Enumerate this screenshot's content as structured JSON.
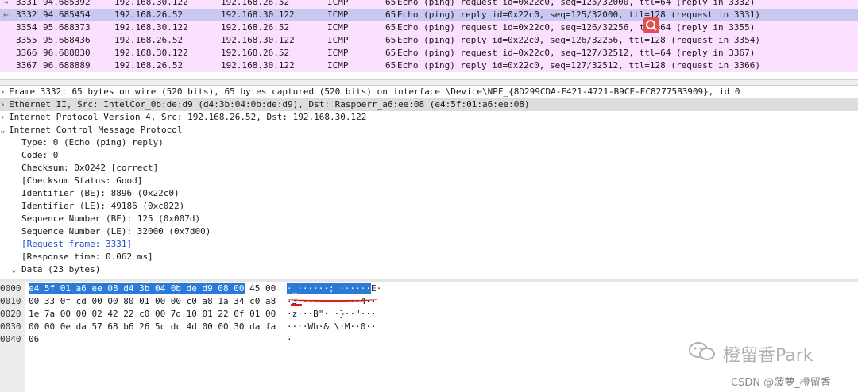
{
  "colors": {
    "icmp_row_bg": "#fce0ff",
    "selected_row_bg": "#c8c8f0",
    "byte_selection": "#2b7bd6",
    "annotation_red": "#d81e1e",
    "details_highlight": "#dddddd"
  },
  "packets": [
    {
      "marker": "→",
      "no": "3331",
      "time": "94.685392",
      "src": "192.168.30.122",
      "dst": "192.168.26.52",
      "proto": "ICMP",
      "len": "65",
      "info": "Echo (ping) request  id=0x22c0, seq=125/32000, ttl=64 (reply in 3332)",
      "selected": false
    },
    {
      "marker": "←",
      "no": "3332",
      "time": "94.685454",
      "src": "192.168.26.52",
      "dst": "192.168.30.122",
      "proto": "ICMP",
      "len": "65",
      "info": "Echo (ping) reply    id=0x22c0, seq=125/32000, ttl=128 (request in 3331)",
      "selected": true
    },
    {
      "marker": "",
      "no": "3354",
      "time": "95.688373",
      "src": "192.168.30.122",
      "dst": "192.168.26.52",
      "proto": "ICMP",
      "len": "65",
      "info": "Echo (ping) request  id=0x22c0, seq=126/32256, ttl=64 (reply in 3355)",
      "selected": false
    },
    {
      "marker": "",
      "no": "3355",
      "time": "95.688436",
      "src": "192.168.26.52",
      "dst": "192.168.30.122",
      "proto": "ICMP",
      "len": "65",
      "info": "Echo (ping) reply    id=0x22c0, seq=126/32256, ttl=128 (request in 3354)",
      "selected": false
    },
    {
      "marker": "",
      "no": "3366",
      "time": "96.688830",
      "src": "192.168.30.122",
      "dst": "192.168.26.52",
      "proto": "ICMP",
      "len": "65",
      "info": "Echo (ping) request  id=0x22c0, seq=127/32512, ttl=64 (reply in 3367)",
      "selected": false
    },
    {
      "marker": "",
      "no": "3367",
      "time": "96.688889",
      "src": "192.168.26.52",
      "dst": "192.168.30.122",
      "proto": "ICMP",
      "len": "65",
      "info": "Echo (ping) reply    id=0x22c0, seq=127/32512, ttl=128 (request in 3366)",
      "selected": false
    }
  ],
  "details": [
    {
      "twisty": "›",
      "indent": 0,
      "text": "Frame 3332: 65 bytes on wire (520 bits), 65 bytes captured (520 bits) on interface \\Device\\NPF_{8D299CDA-F421-4721-B9CE-EC82775B3909}, id 0",
      "highlight": false,
      "link": false
    },
    {
      "twisty": "›",
      "indent": 0,
      "text": "Ethernet II, Src: IntelCor_0b:de:d9 (d4:3b:04:0b:de:d9), Dst: Raspberr_a6:ee:08 (e4:5f:01:a6:ee:08)",
      "highlight": true,
      "link": false
    },
    {
      "twisty": "›",
      "indent": 0,
      "text": "Internet Protocol Version 4, Src: 192.168.26.52, Dst: 192.168.30.122",
      "highlight": false,
      "link": false
    },
    {
      "twisty": "⌄",
      "indent": 0,
      "text": "Internet Control Message Protocol",
      "highlight": false,
      "link": false
    },
    {
      "twisty": "",
      "indent": 1,
      "text": "Type: 0 (Echo (ping) reply)",
      "highlight": false,
      "link": false
    },
    {
      "twisty": "",
      "indent": 1,
      "text": "Code: 0",
      "highlight": false,
      "link": false
    },
    {
      "twisty": "",
      "indent": 1,
      "text": "Checksum: 0x0242 [correct]",
      "highlight": false,
      "link": false
    },
    {
      "twisty": "",
      "indent": 1,
      "text": "[Checksum Status: Good]",
      "highlight": false,
      "link": false
    },
    {
      "twisty": "",
      "indent": 1,
      "text": "Identifier (BE): 8896 (0x22c0)",
      "highlight": false,
      "link": false
    },
    {
      "twisty": "",
      "indent": 1,
      "text": "Identifier (LE): 49186 (0xc022)",
      "highlight": false,
      "link": false
    },
    {
      "twisty": "",
      "indent": 1,
      "text": "Sequence Number (BE): 125 (0x007d)",
      "highlight": false,
      "link": false
    },
    {
      "twisty": "",
      "indent": 1,
      "text": "Sequence Number (LE): 32000 (0x7d00)",
      "highlight": false,
      "link": false
    },
    {
      "twisty": "",
      "indent": 1,
      "text": "[Request frame: 3331]",
      "highlight": false,
      "link": true
    },
    {
      "twisty": "",
      "indent": 1,
      "text": "[Response time: 0.062 ms]",
      "highlight": false,
      "link": false
    },
    {
      "twisty": "⌄",
      "indent": 1,
      "text": "Data (23 bytes)",
      "highlight": false,
      "link": false
    }
  ],
  "bytes": [
    {
      "offset": "0000",
      "hex_sel": "e4 5f 01 a6 ee 08 d4 3b  04 0b de d9 08 00",
      "hex_rest": " 45 00",
      "ascii_sel": "·_······;  ······",
      "ascii_rest": "E·"
    },
    {
      "offset": "0010",
      "hex_sel": "",
      "hex_rest": "00 33 0f cd 00 00 80 01  00 00 c0 a8 1a 34 c0 a8",
      "ascii_sel": "",
      "ascii_rest": "·3······ ·····4··"
    },
    {
      "offset": "0020",
      "hex_sel": "",
      "hex_rest": "1e 7a 00 00 02 42 22 c0  00 7d 10 01 22 0f 01 00",
      "ascii_sel": "",
      "ascii_rest": "·z···B\"· ·}··\"···"
    },
    {
      "offset": "0030",
      "hex_sel": "",
      "hex_rest": "00 00 0e da 57 68 b6 26  5c dc 4d 00 00 30 da fa",
      "ascii_sel": "",
      "ascii_rest": "····Wh·& \\·M··0··"
    },
    {
      "offset": "0040",
      "hex_sel": "",
      "hex_rest": "06",
      "ascii_sel": "",
      "ascii_rest": "·"
    }
  ],
  "watermark": {
    "brand": "橙留香Park",
    "csdn": "CSDN @菠萝_橙留香"
  },
  "icons": {
    "search_badge": "search-icon",
    "wechat": "wechat-icon"
  }
}
